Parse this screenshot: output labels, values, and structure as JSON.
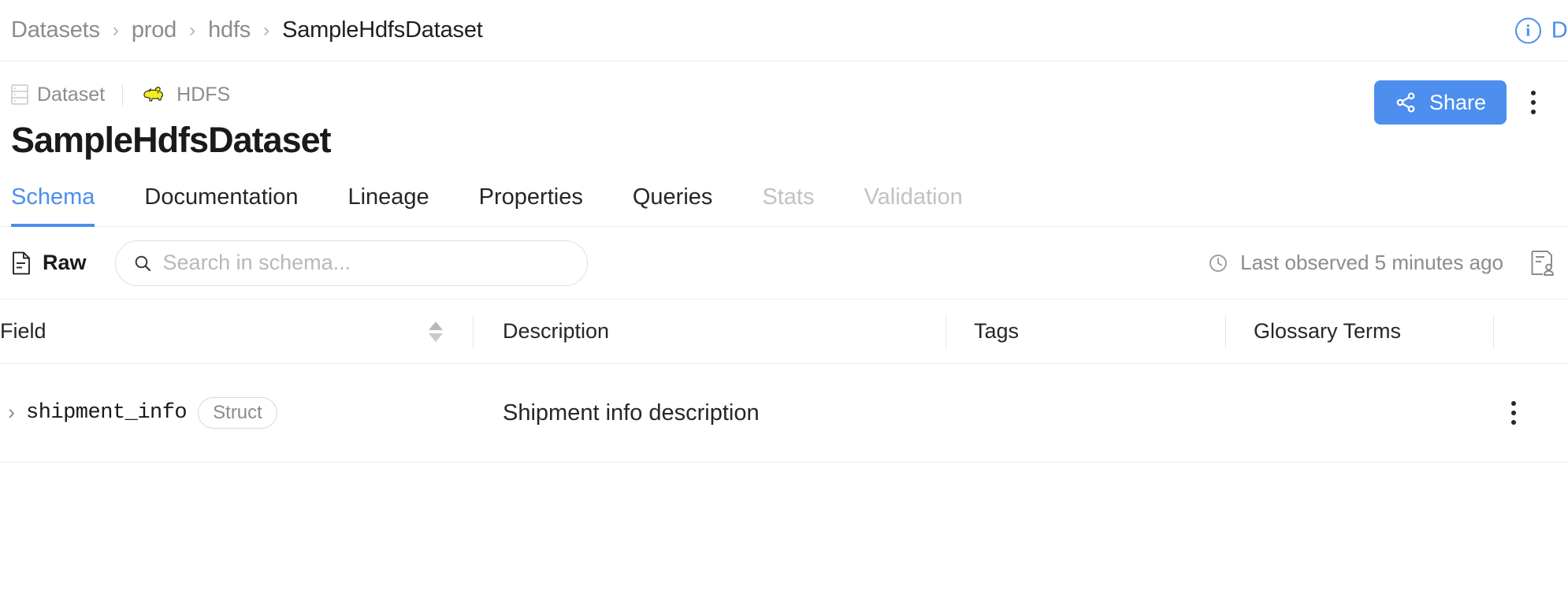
{
  "breadcrumb": {
    "items": [
      {
        "label": "Datasets",
        "active": false
      },
      {
        "label": "prod",
        "active": false
      },
      {
        "label": "hdfs",
        "active": false
      },
      {
        "label": "SampleHdfsDataset",
        "active": true
      }
    ],
    "separator": "›",
    "details_link": "Deta",
    "info_icon": "info-icon"
  },
  "header": {
    "entity_type": "Dataset",
    "entity_type_icon": "dataset-icon",
    "platform": "HDFS",
    "platform_icon": "hadoop-elephant-icon",
    "title": "SampleHdfsDataset",
    "share_label": "Share",
    "share_icon": "share-icon",
    "more_menu_icon": "kebab-menu-icon"
  },
  "tabs": [
    {
      "label": "Schema",
      "active": true,
      "disabled": false
    },
    {
      "label": "Documentation",
      "active": false,
      "disabled": false
    },
    {
      "label": "Lineage",
      "active": false,
      "disabled": false
    },
    {
      "label": "Properties",
      "active": false,
      "disabled": false
    },
    {
      "label": "Queries",
      "active": false,
      "disabled": false
    },
    {
      "label": "Stats",
      "active": false,
      "disabled": true
    },
    {
      "label": "Validation",
      "active": false,
      "disabled": true
    }
  ],
  "toolbar": {
    "raw_label": "Raw",
    "raw_icon": "document-icon",
    "search_placeholder": "Search in schema...",
    "search_value": "",
    "search_icon": "search-icon",
    "last_observed": "Last observed 5 minutes ago",
    "clock_icon": "clock-icon",
    "report_icon": "schema-report-icon"
  },
  "table": {
    "columns": [
      {
        "label": "Field",
        "sortable": true
      },
      {
        "label": "Description",
        "sortable": false
      },
      {
        "label": "Tags",
        "sortable": false
      },
      {
        "label": "Glossary Terms",
        "sortable": false
      }
    ],
    "rows": [
      {
        "expander": "›",
        "field": "shipment_info",
        "type": "Struct",
        "description": "Shipment info description",
        "tags": "",
        "glossary_terms": "",
        "row_menu_icon": "kebab-menu-icon"
      }
    ]
  },
  "colors": {
    "accent": "#4d8eee",
    "text_primary": "#262626",
    "text_muted": "#8c8c8c",
    "text_disabled": "#c2c2c2",
    "border": "#ededed",
    "hadoop_yellow": "#f7e733"
  }
}
